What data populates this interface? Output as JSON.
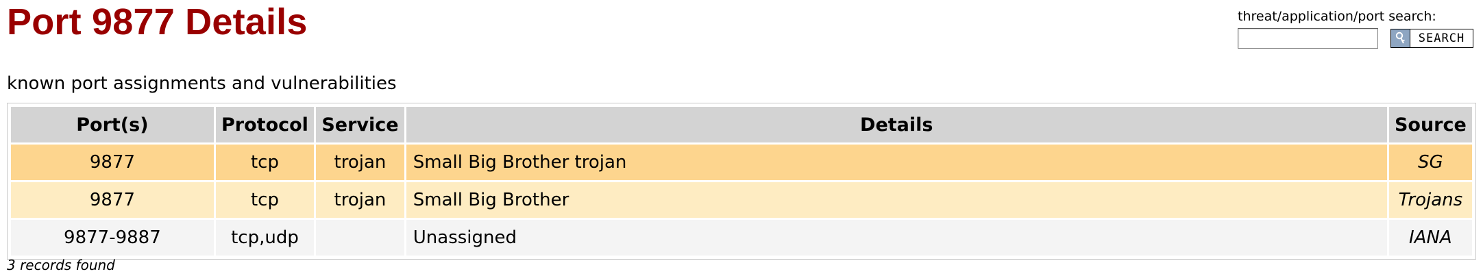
{
  "page": {
    "title": "Port 9877 Details",
    "subtitle": "known port assignments and vulnerabilities",
    "records_found": "3 records found"
  },
  "search": {
    "label": "threat/application/port search:",
    "value": "",
    "placeholder": "",
    "button_label": "SEARCH",
    "button_icon": "key-icon"
  },
  "table": {
    "headers": {
      "ports": "Port(s)",
      "protocol": "Protocol",
      "service": "Service",
      "details": "Details",
      "source": "Source"
    },
    "rows": [
      {
        "ports": "9877",
        "protocol": "tcp",
        "service": "trojan",
        "details": "Small Big Brother trojan",
        "source": "SG"
      },
      {
        "ports": "9877",
        "protocol": "tcp",
        "service": "trojan",
        "details": "Small Big Brother",
        "source": "Trojans"
      },
      {
        "ports": "9877-9887",
        "protocol": "tcp,udp",
        "service": "",
        "details": "Unassigned",
        "source": "IANA"
      }
    ]
  },
  "colors": {
    "title": "#990000",
    "header_bg": "#d3d3d3",
    "row_highlight": "#fdd58e",
    "row_light": "#feecc2",
    "row_neutral": "#f4f4f4"
  }
}
